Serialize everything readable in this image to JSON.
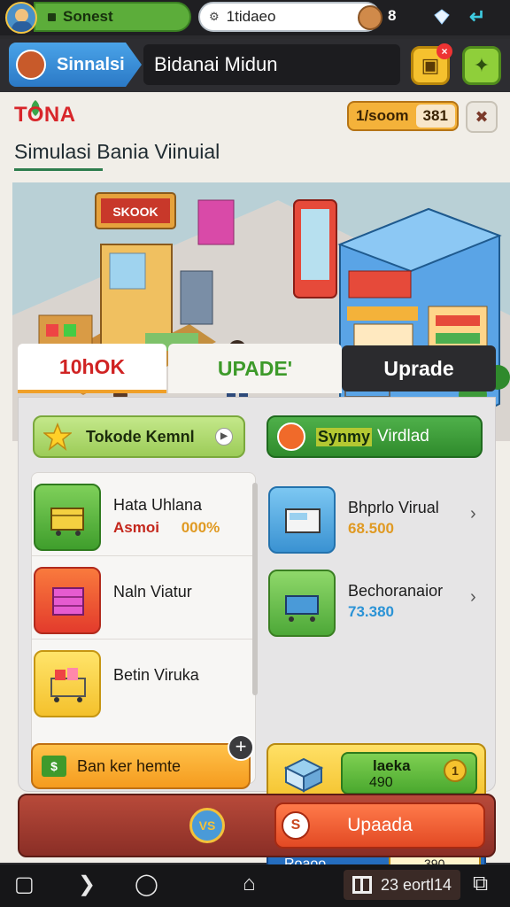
{
  "status_bar": {
    "tab_label": "Sonest",
    "search_value": "1tidaeo",
    "count": "8"
  },
  "header": {
    "tab_label": "Sinnalsi",
    "title": "Bidanai Midun",
    "notification_badge": "×"
  },
  "brand": {
    "name": "TONA",
    "coins": "1/soom",
    "coins_secondary": "381"
  },
  "subtitle": "Simulasi Bania Viinuial",
  "tabs": [
    {
      "label": "10hOK"
    },
    {
      "label": "UPADE'"
    },
    {
      "label": "Uprade"
    }
  ],
  "shop_sign": "SKOOK",
  "quick_buttons": {
    "left": "Tokode Kemnl",
    "right_highlight": "Synmy",
    "right_rest": "Virdlad"
  },
  "left_items": [
    {
      "title": "Hata Uhlana",
      "sub_a": "Asmoi",
      "sub_b": "000%"
    },
    {
      "title": "Naln Viatur"
    },
    {
      "title": "Betin Viruka"
    }
  ],
  "left_button": "Ban ker hemte",
  "right_items": [
    {
      "title": "Bhprlo Virual",
      "sub": "68.500",
      "sub_color": "#e09a23"
    },
    {
      "title": "Bechoranaior",
      "sub": "73.380",
      "sub_color": "#2b93d6"
    }
  ],
  "yellow_panel": {
    "title": "laeka",
    "value": "490",
    "coin": "1"
  },
  "blue_panel": {
    "left": "Roaoo",
    "right": "390"
  },
  "action": {
    "badge": "VS",
    "button": "Upaada",
    "button_icon": "S"
  },
  "nav": {
    "time": "23 eortl14"
  },
  "icons": [
    "avatar-icon",
    "diamond-icon",
    "swirl-icon",
    "tool-icon",
    "briefcase-icon",
    "puzzle-icon",
    "wrench-icon",
    "star-icon",
    "play-icon",
    "cart-icon",
    "money-icon",
    "coin-icon",
    "back-icon",
    "home-icon",
    "recents-icon"
  ],
  "colors": {
    "accent_red": "#d8262a",
    "accent_green": "#3d9a2a",
    "accent_orange": "#f59b1e",
    "dark": "#2b2b2e"
  }
}
